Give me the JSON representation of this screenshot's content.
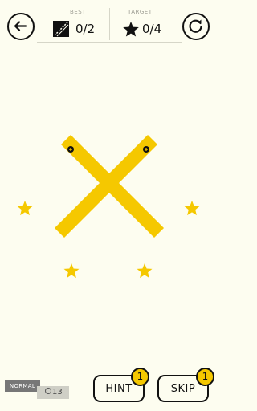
{
  "header": {
    "best": {
      "caption": "BEST",
      "value": "0/2",
      "icon": "best-lines-icon"
    },
    "target": {
      "caption": "TARGET",
      "value": "0/4",
      "icon": "star-icon"
    },
    "back_icon": "back-arrow-icon",
    "restart_icon": "restart-icon"
  },
  "board": {
    "stars_total": 4,
    "bars": [
      {
        "name": "bar-left-top-to-right-bottom",
        "pin_icon": "plus-pin-icon"
      },
      {
        "name": "bar-right-top-to-left-bottom",
        "pin_icon": "plus-pin-icon"
      }
    ]
  },
  "footer": {
    "difficulty": "NORMAL",
    "level": "13",
    "hint": {
      "label": "HINT",
      "count": "1"
    },
    "skip": {
      "label": "SKIP",
      "count": "1"
    }
  },
  "colors": {
    "background": "#fdfdf0",
    "accent_yellow": "#f5c800",
    "ink": "#111111",
    "tag_gray": "#777777"
  }
}
